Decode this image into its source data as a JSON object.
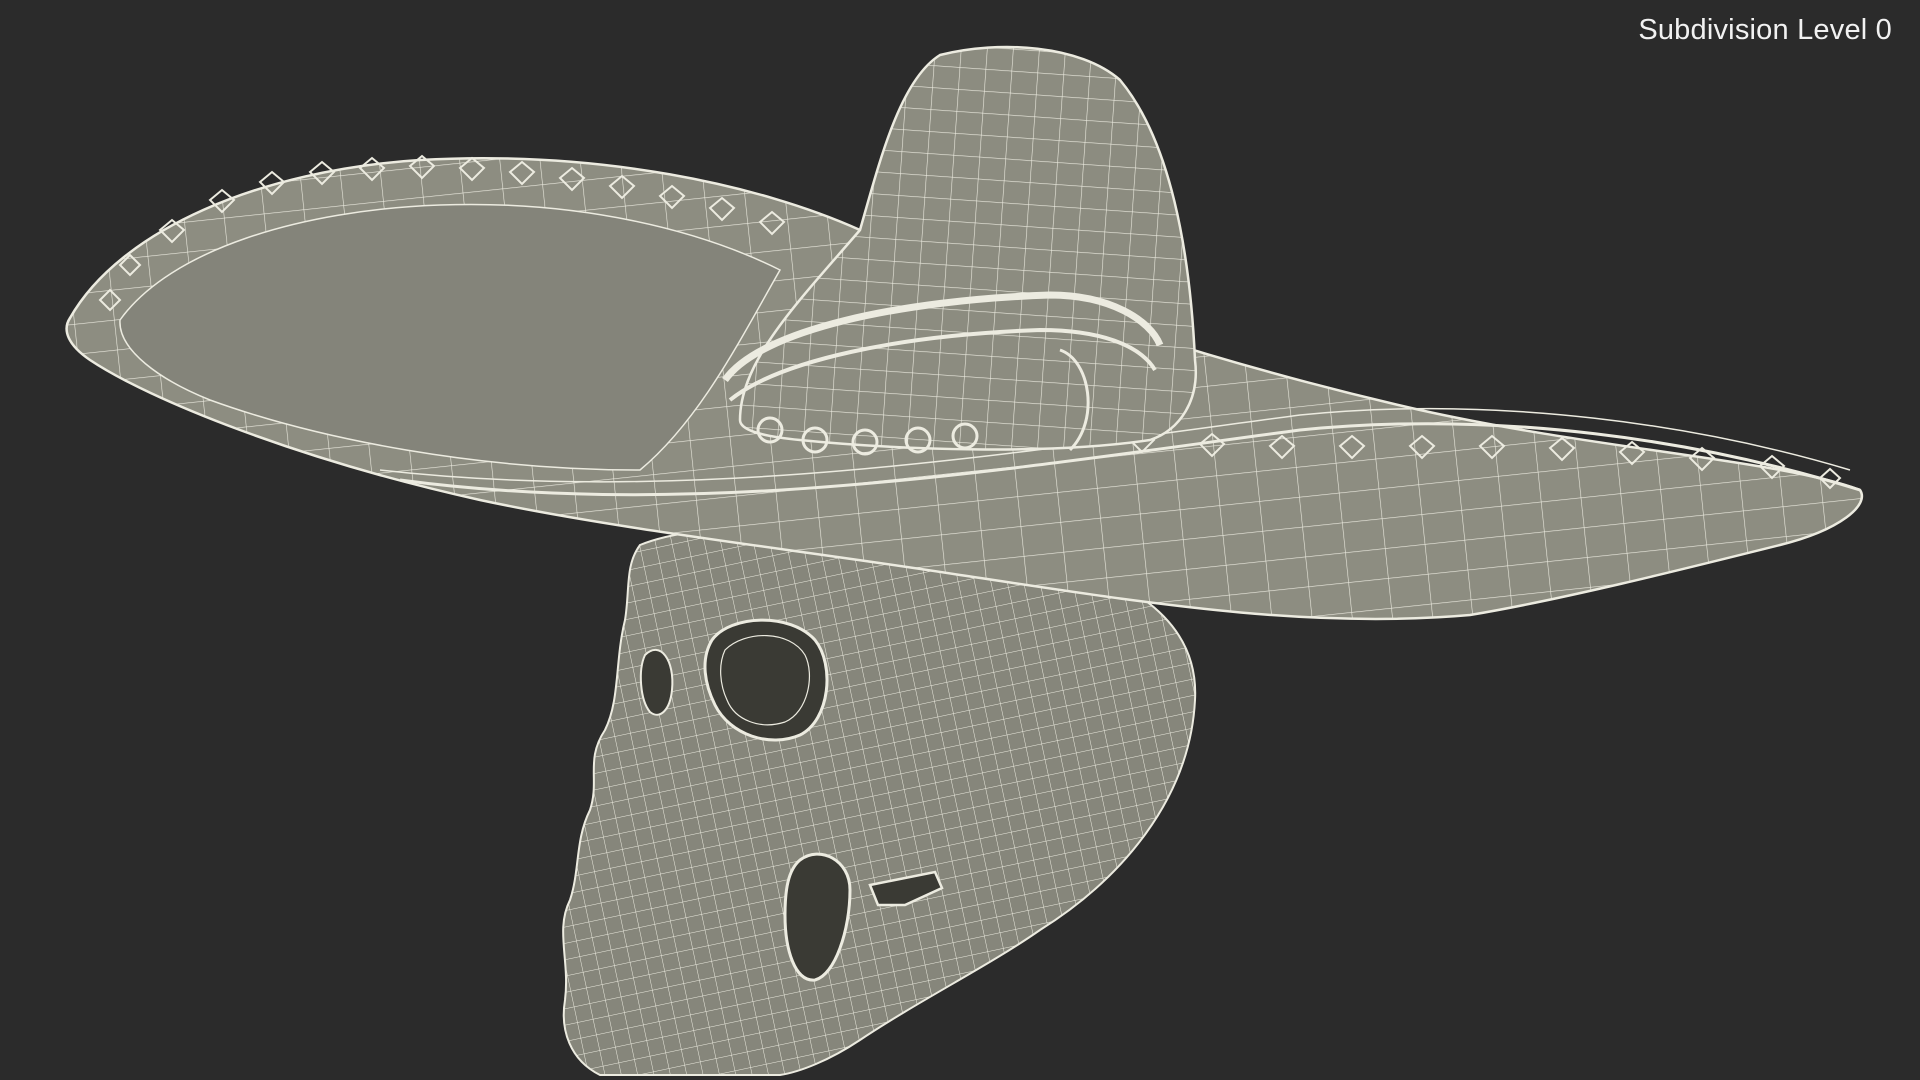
{
  "viewport": {
    "label": "Subdivision Level 0",
    "background_color": "#2b2b2b",
    "model_fill_color": "#8a8a7e",
    "wire_color": "#ecebe0"
  }
}
